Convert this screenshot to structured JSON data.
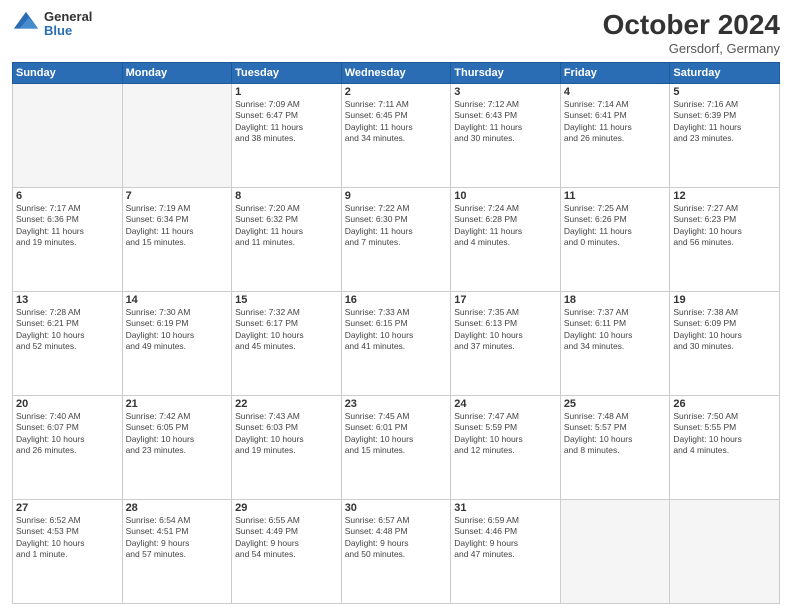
{
  "header": {
    "logo_general": "General",
    "logo_blue": "Blue",
    "month_title": "October 2024",
    "location": "Gersdorf, Germany"
  },
  "days_of_week": [
    "Sunday",
    "Monday",
    "Tuesday",
    "Wednesday",
    "Thursday",
    "Friday",
    "Saturday"
  ],
  "weeks": [
    [
      {
        "day": "",
        "info": ""
      },
      {
        "day": "",
        "info": ""
      },
      {
        "day": "1",
        "info": "Sunrise: 7:09 AM\nSunset: 6:47 PM\nDaylight: 11 hours\nand 38 minutes."
      },
      {
        "day": "2",
        "info": "Sunrise: 7:11 AM\nSunset: 6:45 PM\nDaylight: 11 hours\nand 34 minutes."
      },
      {
        "day": "3",
        "info": "Sunrise: 7:12 AM\nSunset: 6:43 PM\nDaylight: 11 hours\nand 30 minutes."
      },
      {
        "day": "4",
        "info": "Sunrise: 7:14 AM\nSunset: 6:41 PM\nDaylight: 11 hours\nand 26 minutes."
      },
      {
        "day": "5",
        "info": "Sunrise: 7:16 AM\nSunset: 6:39 PM\nDaylight: 11 hours\nand 23 minutes."
      }
    ],
    [
      {
        "day": "6",
        "info": "Sunrise: 7:17 AM\nSunset: 6:36 PM\nDaylight: 11 hours\nand 19 minutes."
      },
      {
        "day": "7",
        "info": "Sunrise: 7:19 AM\nSunset: 6:34 PM\nDaylight: 11 hours\nand 15 minutes."
      },
      {
        "day": "8",
        "info": "Sunrise: 7:20 AM\nSunset: 6:32 PM\nDaylight: 11 hours\nand 11 minutes."
      },
      {
        "day": "9",
        "info": "Sunrise: 7:22 AM\nSunset: 6:30 PM\nDaylight: 11 hours\nand 7 minutes."
      },
      {
        "day": "10",
        "info": "Sunrise: 7:24 AM\nSunset: 6:28 PM\nDaylight: 11 hours\nand 4 minutes."
      },
      {
        "day": "11",
        "info": "Sunrise: 7:25 AM\nSunset: 6:26 PM\nDaylight: 11 hours\nand 0 minutes."
      },
      {
        "day": "12",
        "info": "Sunrise: 7:27 AM\nSunset: 6:23 PM\nDaylight: 10 hours\nand 56 minutes."
      }
    ],
    [
      {
        "day": "13",
        "info": "Sunrise: 7:28 AM\nSunset: 6:21 PM\nDaylight: 10 hours\nand 52 minutes."
      },
      {
        "day": "14",
        "info": "Sunrise: 7:30 AM\nSunset: 6:19 PM\nDaylight: 10 hours\nand 49 minutes."
      },
      {
        "day": "15",
        "info": "Sunrise: 7:32 AM\nSunset: 6:17 PM\nDaylight: 10 hours\nand 45 minutes."
      },
      {
        "day": "16",
        "info": "Sunrise: 7:33 AM\nSunset: 6:15 PM\nDaylight: 10 hours\nand 41 minutes."
      },
      {
        "day": "17",
        "info": "Sunrise: 7:35 AM\nSunset: 6:13 PM\nDaylight: 10 hours\nand 37 minutes."
      },
      {
        "day": "18",
        "info": "Sunrise: 7:37 AM\nSunset: 6:11 PM\nDaylight: 10 hours\nand 34 minutes."
      },
      {
        "day": "19",
        "info": "Sunrise: 7:38 AM\nSunset: 6:09 PM\nDaylight: 10 hours\nand 30 minutes."
      }
    ],
    [
      {
        "day": "20",
        "info": "Sunrise: 7:40 AM\nSunset: 6:07 PM\nDaylight: 10 hours\nand 26 minutes."
      },
      {
        "day": "21",
        "info": "Sunrise: 7:42 AM\nSunset: 6:05 PM\nDaylight: 10 hours\nand 23 minutes."
      },
      {
        "day": "22",
        "info": "Sunrise: 7:43 AM\nSunset: 6:03 PM\nDaylight: 10 hours\nand 19 minutes."
      },
      {
        "day": "23",
        "info": "Sunrise: 7:45 AM\nSunset: 6:01 PM\nDaylight: 10 hours\nand 15 minutes."
      },
      {
        "day": "24",
        "info": "Sunrise: 7:47 AM\nSunset: 5:59 PM\nDaylight: 10 hours\nand 12 minutes."
      },
      {
        "day": "25",
        "info": "Sunrise: 7:48 AM\nSunset: 5:57 PM\nDaylight: 10 hours\nand 8 minutes."
      },
      {
        "day": "26",
        "info": "Sunrise: 7:50 AM\nSunset: 5:55 PM\nDaylight: 10 hours\nand 4 minutes."
      }
    ],
    [
      {
        "day": "27",
        "info": "Sunrise: 6:52 AM\nSunset: 4:53 PM\nDaylight: 10 hours\nand 1 minute."
      },
      {
        "day": "28",
        "info": "Sunrise: 6:54 AM\nSunset: 4:51 PM\nDaylight: 9 hours\nand 57 minutes."
      },
      {
        "day": "29",
        "info": "Sunrise: 6:55 AM\nSunset: 4:49 PM\nDaylight: 9 hours\nand 54 minutes."
      },
      {
        "day": "30",
        "info": "Sunrise: 6:57 AM\nSunset: 4:48 PM\nDaylight: 9 hours\nand 50 minutes."
      },
      {
        "day": "31",
        "info": "Sunrise: 6:59 AM\nSunset: 4:46 PM\nDaylight: 9 hours\nand 47 minutes."
      },
      {
        "day": "",
        "info": ""
      },
      {
        "day": "",
        "info": ""
      }
    ]
  ]
}
